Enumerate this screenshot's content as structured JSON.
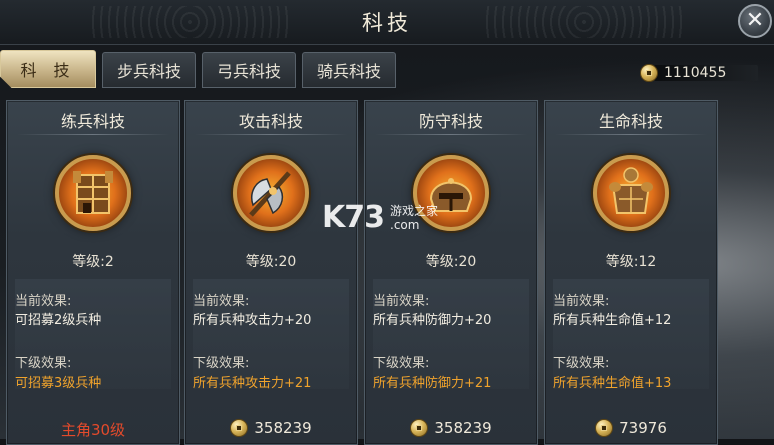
{
  "header": {
    "title": "科技",
    "close_icon": "close-icon"
  },
  "tabs": [
    {
      "label": "科 技",
      "active": true
    },
    {
      "label": "步兵科技",
      "active": false
    },
    {
      "label": "弓兵科技",
      "active": false
    },
    {
      "label": "骑兵科技",
      "active": false
    }
  ],
  "currency": {
    "icon": "coin-icon",
    "amount": "1110455"
  },
  "cards": [
    {
      "title": "练兵科技",
      "icon": "training-fortress-icon",
      "level": "等级:2",
      "current_label": "当前效果:",
      "current_value": "可招募2级兵种",
      "next_label": "下级效果:",
      "next_value": "可招募3级兵种",
      "cost": "主角30级",
      "cost_is_requirement": true
    },
    {
      "title": "攻击科技",
      "icon": "battle-axe-icon",
      "level": "等级:20",
      "current_label": "当前效果:",
      "current_value": "所有兵种攻击力+20",
      "next_label": "下级效果:",
      "next_value": "所有兵种攻击力+21",
      "cost": "358239",
      "cost_is_requirement": false
    },
    {
      "title": "防守科技",
      "icon": "helmet-icon",
      "level": "等级:20",
      "current_label": "当前效果:",
      "current_value": "所有兵种防御力+20",
      "next_label": "下级效果:",
      "next_value": "所有兵种防御力+21",
      "cost": "358239",
      "cost_is_requirement": false
    },
    {
      "title": "生命科技",
      "icon": "armor-icon",
      "level": "等级:12",
      "current_label": "当前效果:",
      "current_value": "所有兵种生命值+12",
      "next_label": "下级效果:",
      "next_value": "所有兵种生命值+13",
      "cost": "73976",
      "cost_is_requirement": false
    }
  ],
  "watermark": {
    "logo": "K73",
    "line1": "游戏之家",
    "line2": ".com"
  },
  "colors": {
    "next_effect": "#f0a32c",
    "requirement": "#e34a2b",
    "accent_gold": "#c8b489"
  }
}
